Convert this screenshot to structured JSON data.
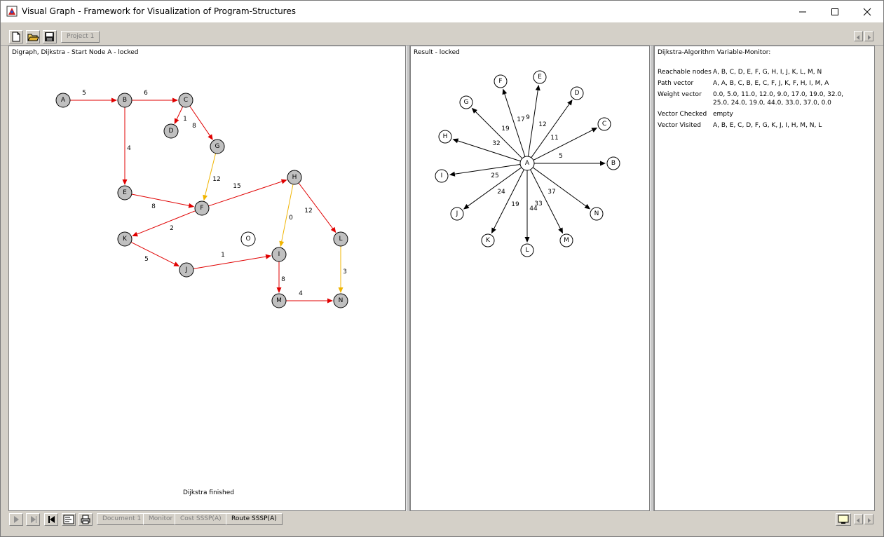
{
  "window": {
    "title": "Visual Graph - Framework for Visualization of Program-Structures"
  },
  "toolbar": {
    "project_tab": "Project 1"
  },
  "left_panel": {
    "title": "Digraph, Dijkstra - Start Node A - locked",
    "status": "Dijkstra finished",
    "graph": {
      "nodes": [
        {
          "id": "A",
          "fill": "#c0c0c0"
        },
        {
          "id": "B",
          "fill": "#c0c0c0"
        },
        {
          "id": "C",
          "fill": "#c0c0c0"
        },
        {
          "id": "D",
          "fill": "#c0c0c0"
        },
        {
          "id": "G",
          "fill": "#c0c0c0"
        },
        {
          "id": "E",
          "fill": "#c0c0c0"
        },
        {
          "id": "F",
          "fill": "#c0c0c0"
        },
        {
          "id": "H",
          "fill": "#c0c0c0"
        },
        {
          "id": "K",
          "fill": "#c0c0c0"
        },
        {
          "id": "O",
          "fill": "#ffffff"
        },
        {
          "id": "L",
          "fill": "#c0c0c0"
        },
        {
          "id": "J",
          "fill": "#c0c0c0"
        },
        {
          "id": "I",
          "fill": "#c0c0c0"
        },
        {
          "id": "M",
          "fill": "#c0c0c0"
        },
        {
          "id": "N",
          "fill": "#c0c0c0"
        }
      ],
      "edges": [
        {
          "from": "A",
          "to": "B",
          "weight": "5",
          "color": "#e00000"
        },
        {
          "from": "B",
          "to": "C",
          "weight": "6",
          "color": "#e00000"
        },
        {
          "from": "C",
          "to": "D",
          "weight": "1",
          "color": "#e00000"
        },
        {
          "from": "C",
          "to": "G",
          "weight": "8",
          "color": "#e00000"
        },
        {
          "from": "B",
          "to": "E",
          "weight": "4",
          "color": "#e00000"
        },
        {
          "from": "G",
          "to": "F",
          "weight": "12",
          "color": "#f0b400"
        },
        {
          "from": "E",
          "to": "F",
          "weight": "8",
          "color": "#e00000"
        },
        {
          "from": "F",
          "to": "H",
          "weight": "15",
          "color": "#e00000"
        },
        {
          "from": "F",
          "to": "K",
          "weight": "2",
          "color": "#e00000"
        },
        {
          "from": "H",
          "to": "I",
          "weight": "0",
          "color": "#f0b400"
        },
        {
          "from": "H",
          "to": "L",
          "weight": "12",
          "color": "#e00000"
        },
        {
          "from": "K",
          "to": "J",
          "weight": "5",
          "color": "#e00000"
        },
        {
          "from": "J",
          "to": "I",
          "weight": "1",
          "color": "#e00000"
        },
        {
          "from": "I",
          "to": "M",
          "weight": "8",
          "color": "#e00000"
        },
        {
          "from": "L",
          "to": "N",
          "weight": "3",
          "color": "#f0b400"
        },
        {
          "from": "M",
          "to": "N",
          "weight": "4",
          "color": "#e00000"
        }
      ]
    }
  },
  "mid_panel": {
    "title": "Result - locked",
    "center": "A",
    "spokes": [
      {
        "id": "F",
        "weight": "17"
      },
      {
        "id": "E",
        "weight": "9"
      },
      {
        "id": "D",
        "weight": "12"
      },
      {
        "id": "C",
        "weight": "11"
      },
      {
        "id": "B",
        "weight": "5"
      },
      {
        "id": "G",
        "weight": "19"
      },
      {
        "id": "H",
        "weight": "32"
      },
      {
        "id": "I",
        "weight": "25"
      },
      {
        "id": "J",
        "weight": "24"
      },
      {
        "id": "K",
        "weight": "19"
      },
      {
        "id": "L",
        "weight": "44"
      },
      {
        "id": "M",
        "weight": "33"
      },
      {
        "id": "N",
        "weight": "37"
      }
    ]
  },
  "right_panel": {
    "title": "Dijkstra-Algorithm Variable-Monitor:",
    "rows": [
      {
        "label": "Reachable nodes",
        "value": "A, B, C, D, E, F, G, H, I, J, K, L, M, N"
      },
      {
        "label": "Path vector",
        "value": "A, A, B, C, B, E, C, F, J, K, F, H, I, M, A"
      },
      {
        "label": "Weight vector",
        "value": "0.0, 5.0, 11.0, 12.0, 9.0, 17.0, 19.0, 32.0,"
      },
      {
        "label": "",
        "value": " 25.0, 24.0, 19.0, 44.0, 33.0, 37.0, 0.0"
      },
      {
        "label": "Vector Checked",
        "value": "empty"
      },
      {
        "label": "Vector Visited",
        "value": "A, B, E, C, D, F, G, K, J, I, H, M, N, L"
      }
    ]
  },
  "bottom_tabs": [
    {
      "label": "Document 1",
      "active": false
    },
    {
      "label": "Monitor",
      "active": false
    },
    {
      "label": "Cost SSSP(A)",
      "active": false
    },
    {
      "label": "Route SSSP(A)",
      "active": true
    }
  ]
}
